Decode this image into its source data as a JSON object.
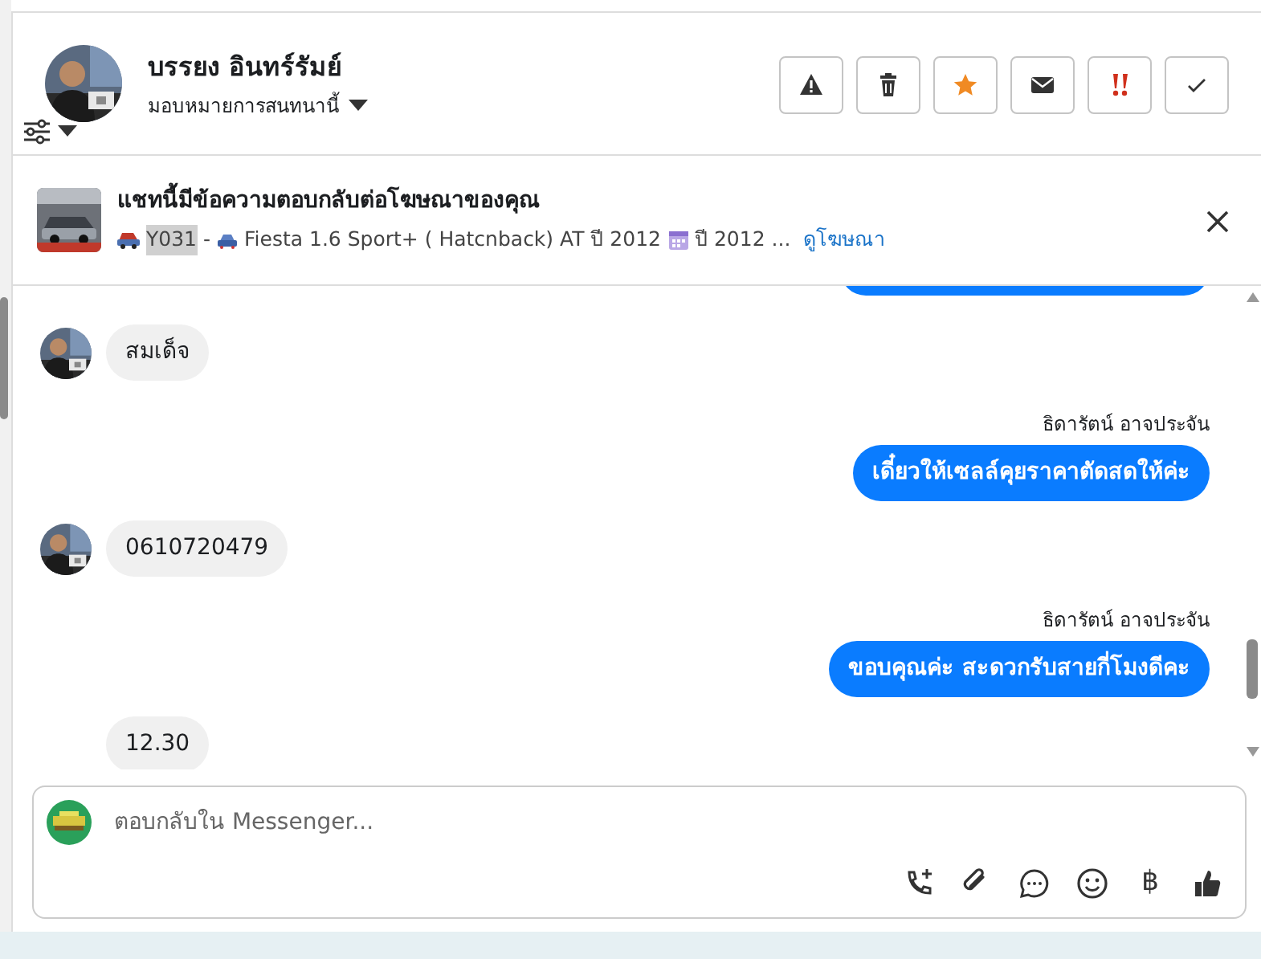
{
  "header": {
    "name": "บรรยง อินทร์รัมย์",
    "assign_label": "มอบหมายการสนทนานี้",
    "actions": [
      {
        "kind": "warning"
      },
      {
        "kind": "trash"
      },
      {
        "kind": "star"
      },
      {
        "kind": "envelope"
      },
      {
        "kind": "urgent"
      },
      {
        "kind": "check"
      }
    ]
  },
  "ad_banner": {
    "title": "แชทนี้มีข้อความตอบกลับต่อโฆษณาของคุณ",
    "code": "Y031",
    "code_highlighted": true,
    "separator": "-",
    "model": "Fiesta 1.6 Sport+ ( Hatcnback) AT ปี 2012",
    "year": "ปี 2012 ...",
    "link": "ดูโฆษณา"
  },
  "messages": [
    {
      "kind": "partial_outgoing"
    },
    {
      "kind": "incoming",
      "avatar": true,
      "text": "สมเด็จ"
    },
    {
      "kind": "outgoing",
      "sender": "ธิดารัตน์ อาจประจัน",
      "text": "เดี๋ยวให้เซลล์คุยราคาตัดสดให้ค่ะ"
    },
    {
      "kind": "incoming",
      "avatar": true,
      "text": "0610720479"
    },
    {
      "kind": "outgoing",
      "sender": "ธิดารัตน์ อาจประจัน",
      "text": "ขอบคุณค่ะ สะดวกรับสายกี่โมงดีคะ"
    },
    {
      "kind": "incoming",
      "avatar": false,
      "text": "12.30"
    }
  ],
  "composer": {
    "placeholder": "ตอบกลับใน Messenger...",
    "tools": [
      {
        "kind": "call"
      },
      {
        "kind": "attach"
      },
      {
        "kind": "chat"
      },
      {
        "kind": "emoji"
      },
      {
        "kind": "text",
        "label": "฿"
      },
      {
        "kind": "like"
      }
    ]
  }
}
